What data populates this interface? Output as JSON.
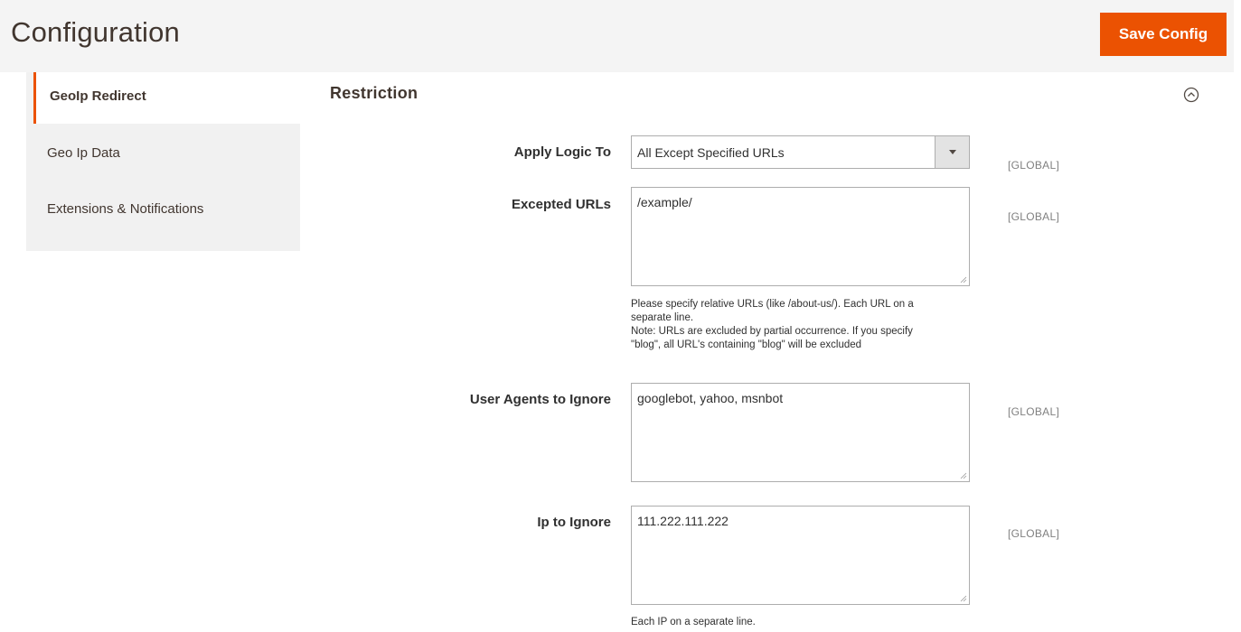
{
  "header": {
    "title": "Configuration",
    "save_label": "Save Config",
    "accent": "#eb5202"
  },
  "sidebar": {
    "items": [
      {
        "label": "GeoIp Redirect",
        "active": true
      },
      {
        "label": "Geo Ip Data",
        "active": false
      },
      {
        "label": "Extensions & Notifications",
        "active": false
      }
    ]
  },
  "section": {
    "title": "Restriction",
    "collapse_icon": "chevron-up-circle-icon"
  },
  "fields": {
    "apply_logic": {
      "label": "Apply Logic To",
      "value": "All Except Specified URLs",
      "scope": "[GLOBAL]"
    },
    "excepted_urls": {
      "label": "Excepted URLs",
      "value": "/example/",
      "scope": "[GLOBAL]",
      "note": [
        "Please specify relative URLs (like /about-us/). Each URL on a",
        "separate line.",
        "Note: URLs are excluded by partial occurrence. If you specify",
        "\"blog\", all URL's containing \"blog\" will be excluded"
      ]
    },
    "user_agents": {
      "label": "User Agents to Ignore",
      "value": "googlebot, yahoo, msnbot",
      "scope": "[GLOBAL]"
    },
    "ip_ignore": {
      "label": "Ip to Ignore",
      "value": "111.222.111.222",
      "scope": "[GLOBAL]",
      "note": "Each IP on a separate line."
    }
  }
}
